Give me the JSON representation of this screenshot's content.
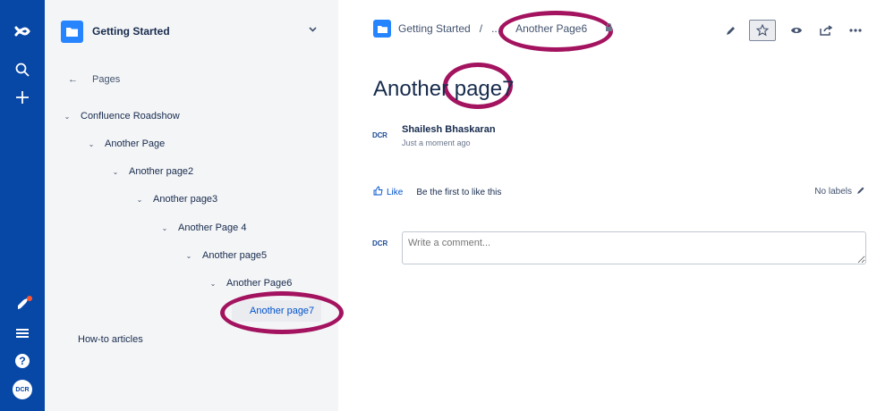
{
  "global_nav": {
    "logo_icon": "confluence-logo-icon",
    "search_icon": "search-icon",
    "create_icon": "plus-icon",
    "notifications_icon": "rocket-icon",
    "menu_icon": "hamburger-menu-icon",
    "help_icon": "help-icon",
    "help_glyph": "?",
    "avatar_text": "DCR"
  },
  "sidebar": {
    "space_name": "Getting Started",
    "back_label": "Pages",
    "tree": [
      {
        "label": "Confluence Roadshow",
        "expanded": true
      },
      {
        "label": "Another Page",
        "expanded": true
      },
      {
        "label": "Another page2",
        "expanded": true
      },
      {
        "label": "Another page3",
        "expanded": true
      },
      {
        "label": "Another Page 4",
        "expanded": true
      },
      {
        "label": "Another page5",
        "expanded": true
      },
      {
        "label": "Another Page6",
        "expanded": true
      },
      {
        "label": "Another page7",
        "active": true
      }
    ],
    "howto_label": "How-to articles"
  },
  "breadcrumb": {
    "items": [
      "Getting Started",
      "/",
      "...",
      "Another Page6"
    ]
  },
  "toolbar": {
    "edit_icon": "pencil-icon",
    "star_icon": "star-icon",
    "watch_icon": "eye-icon",
    "share_icon": "share-icon",
    "more_icon": "more-icon"
  },
  "page": {
    "title": "Another page7",
    "author": "Shailesh Bhaskaran",
    "time": "Just a moment ago",
    "logo_text": "DCR"
  },
  "likes": {
    "like_label": "Like",
    "like_text": "Be the first to like this",
    "labels_text": "No labels"
  },
  "comment": {
    "placeholder": "Write a comment..."
  },
  "colors": {
    "nav": "#0747a6",
    "sidebar": "#f4f5f7",
    "accent": "#2684ff",
    "annotation": "#a3135f"
  }
}
